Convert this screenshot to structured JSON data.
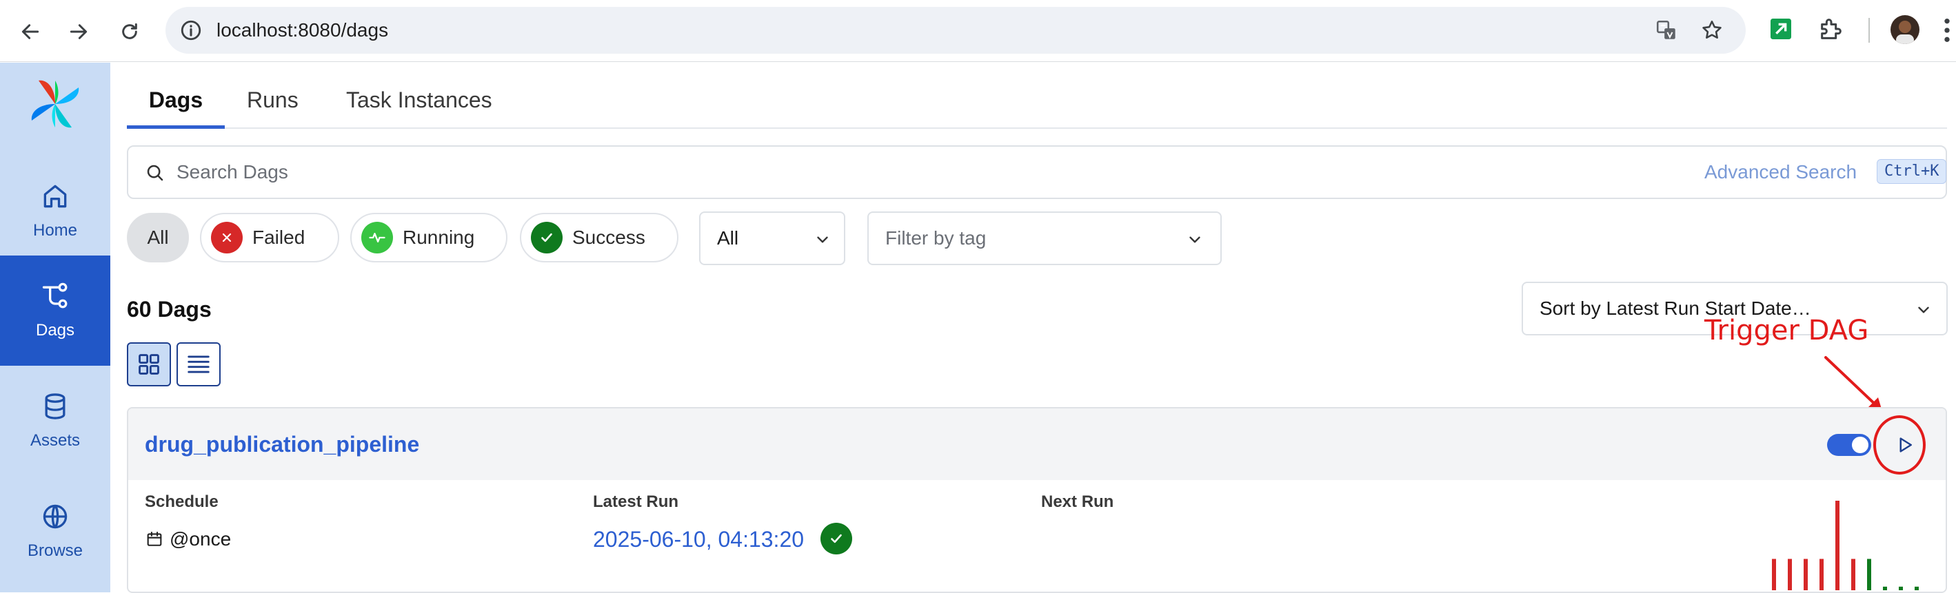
{
  "browser": {
    "url": "localhost:8080/dags"
  },
  "sidebar": {
    "items": [
      {
        "label": "Home",
        "icon": "home-icon"
      },
      {
        "label": "Dags",
        "icon": "dags-icon",
        "active": true
      },
      {
        "label": "Assets",
        "icon": "database-icon"
      },
      {
        "label": "Browse",
        "icon": "globe-icon"
      }
    ]
  },
  "tabs": [
    {
      "label": "Dags",
      "active": true
    },
    {
      "label": "Runs"
    },
    {
      "label": "Task Instances"
    }
  ],
  "search": {
    "placeholder": "Search Dags",
    "advanced_label": "Advanced Search",
    "shortcut": "Ctrl+K"
  },
  "filters": {
    "state_chips": [
      {
        "label": "All",
        "selected": true
      },
      {
        "label": "Failed",
        "color": "#d62828"
      },
      {
        "label": "Running",
        "color": "#38c442"
      },
      {
        "label": "Success",
        "color": "#0f7a1e"
      }
    ],
    "paused_select": "All",
    "tag_placeholder": "Filter by tag"
  },
  "results": {
    "count_label": "60 Dags"
  },
  "sort": {
    "label": "Sort by Latest Run Start Date…"
  },
  "annotation": {
    "text": "Trigger DAG",
    "color": "#e21b1b"
  },
  "dag_card": {
    "name": "drug_publication_pipeline",
    "active": true,
    "schedule_label": "Schedule",
    "schedule_value": "@once",
    "latest_run_label": "Latest Run",
    "latest_run_value": "2025-06-10, 04:13:20",
    "latest_run_state": "success",
    "next_run_label": "Next Run",
    "run_bars": [
      {
        "state": "failed",
        "level": 0.35
      },
      {
        "state": "failed",
        "level": 0.35
      },
      {
        "state": "failed",
        "level": 0.35
      },
      {
        "state": "failed",
        "level": 0.35
      },
      {
        "state": "failed",
        "level": 1.0
      },
      {
        "state": "failed",
        "level": 0.35
      },
      {
        "state": "success",
        "level": 0.35
      },
      {
        "state": "queued",
        "level": 0.04
      },
      {
        "state": "queued",
        "level": 0.04
      },
      {
        "state": "queued",
        "level": 0.04
      }
    ]
  },
  "colors": {
    "accent": "#2157c7",
    "sidebar_bg": "#c9dcf5",
    "failed": "#d62828",
    "success": "#0f7a1e"
  }
}
